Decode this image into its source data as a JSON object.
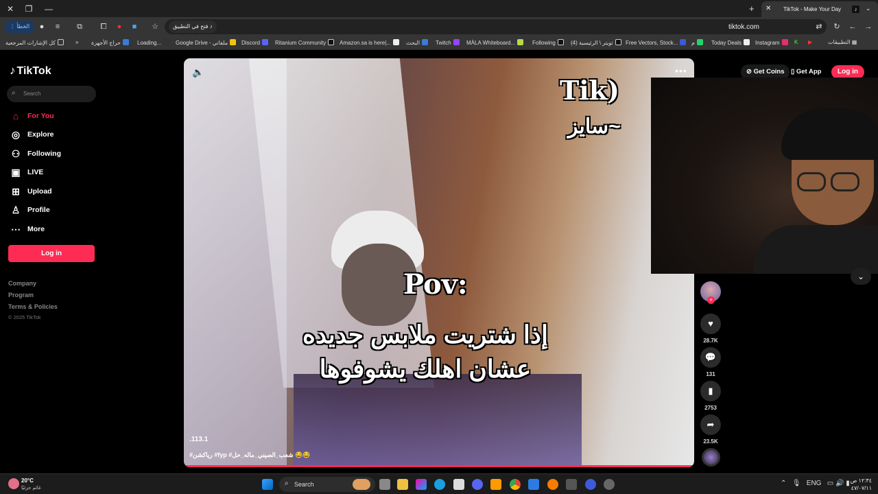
{
  "browser": {
    "tab_title": "TikTok - Make Your Day",
    "url": "tiktok.com",
    "open_in_app": "فتح في التطبيق",
    "error_button": "الخطأ",
    "bookmarks": [
      "كل الإشارات المرجعية",
      "حراج الأجهزة",
      "Loading...",
      "Google Drive - ملفاتي",
      "Discord",
      "Ritanium Community",
      "Amazon.sa is here|...",
      "البحث",
      "Twitch",
      "MÀLA Whiteboard...",
      "Following",
      "(4) تويتر \\ الرئيسية",
      "Free Vectors, Stock...",
      "م",
      "Today Deals",
      "Instagram",
      "التطبيقات"
    ]
  },
  "tiktok": {
    "logo": "TikTok",
    "search_placeholder": "Search",
    "nav": [
      {
        "label": "For You",
        "icon": "home-icon"
      },
      {
        "label": "Explore",
        "icon": "compass-icon"
      },
      {
        "label": "Following",
        "icon": "people-icon"
      },
      {
        "label": "LIVE",
        "icon": "live-icon"
      },
      {
        "label": "Upload",
        "icon": "upload-icon"
      },
      {
        "label": "Profile",
        "icon": "profile-icon"
      },
      {
        "label": "More",
        "icon": "more-icon"
      }
    ],
    "login": "Log in",
    "footer": [
      "Company",
      "Program",
      "Terms & Policies"
    ],
    "copyright": "© 2025 TikTok",
    "get_coins": "Get Coins",
    "get_app": "Get App",
    "login_top": "Log in",
    "accent": "#fe2c55"
  },
  "video": {
    "title_text": "Tik)",
    "subtitle_text": "سايز~",
    "pov": "Pov:",
    "caption_line1": "إذا شتريت ملابس جديده",
    "caption_line2": "عشان اهلك يشوفوها",
    "handle": ".113.1",
    "tags": "#رياكشن #fyp #شعب_الصيني_ماله_حل 😂😂"
  },
  "actions": {
    "likes": "28.7K",
    "comments": "131",
    "saves": "2753",
    "shares": "23.5K"
  },
  "taskbar": {
    "temperature": "20°C",
    "weather_desc": "غائم جزئيًا",
    "search": "Search",
    "lang": "ENG",
    "time": "١٢:٣٤ ص",
    "date": "٤٧/٠٧/١١"
  }
}
